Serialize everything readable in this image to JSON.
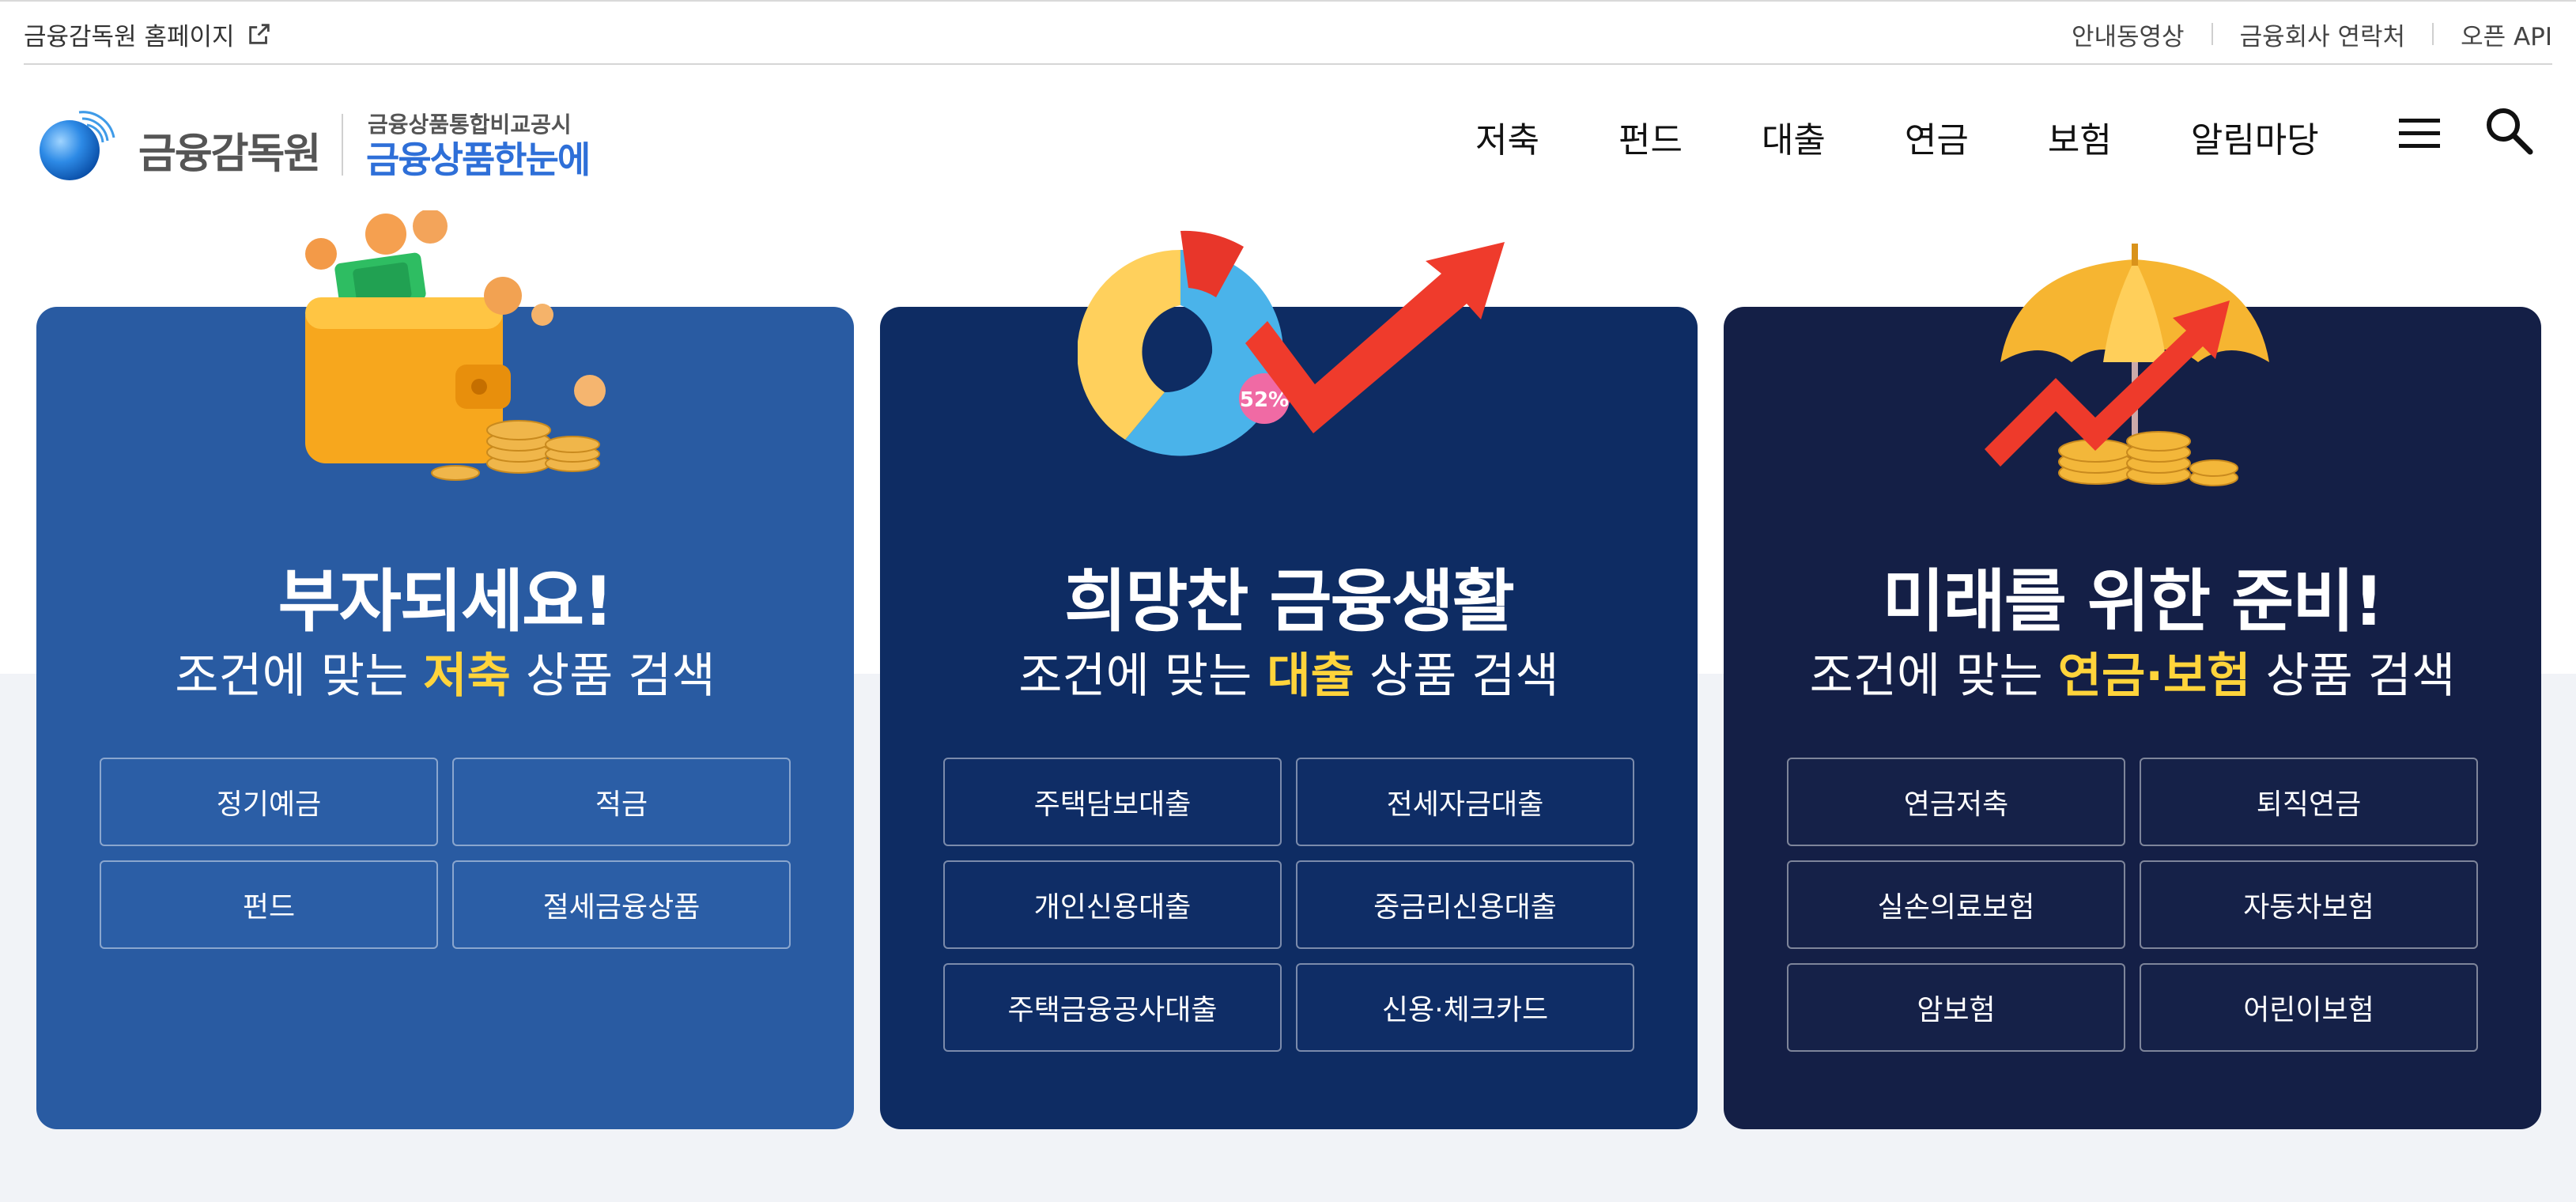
{
  "util_bar": {
    "home_label": "금융감독원 홈페이지",
    "right_items": [
      "안내동영상",
      "금융회사 연락처",
      "오픈 API"
    ]
  },
  "header": {
    "logo_text": "금융감독원",
    "service_subtitle": "금융상품통합비교공시",
    "service_title": "금융상품한눈에",
    "nav": [
      "저축",
      "펀드",
      "대출",
      "연금",
      "보험",
      "알림마당"
    ]
  },
  "cards": [
    {
      "title": "부자되세요!",
      "sub_prefix": "조건에 맞는 ",
      "sub_highlight": "저축",
      "sub_suffix": " 상품 검색",
      "buttons": [
        "정기예금",
        "적금",
        "펀드",
        "절세금융상품"
      ]
    },
    {
      "title": "희망찬 금융생활",
      "sub_prefix": "조건에 맞는 ",
      "sub_highlight": "대출",
      "sub_suffix": " 상품 검색",
      "badge": "52%",
      "buttons": [
        "주택담보대출",
        "전세자금대출",
        "개인신용대출",
        "중금리신용대출",
        "주택금융공사대출",
        "신용·체크카드"
      ]
    },
    {
      "title": "미래를 위한 준비!",
      "sub_prefix": "조건에 맞는 ",
      "sub_highlight": "연금·보험",
      "sub_suffix": " 상품 검색",
      "buttons": [
        "연금저축",
        "퇴직연금",
        "실손의료보험",
        "자동차보험",
        "암보험",
        "어린이보험"
      ]
    }
  ],
  "colors": {
    "card1_bg": "#295ba2",
    "card2_bg": "#0e2c63",
    "card3_bg": "#141f46",
    "highlight": "#ffd43b",
    "brand_blue": "#2e6fd8"
  }
}
